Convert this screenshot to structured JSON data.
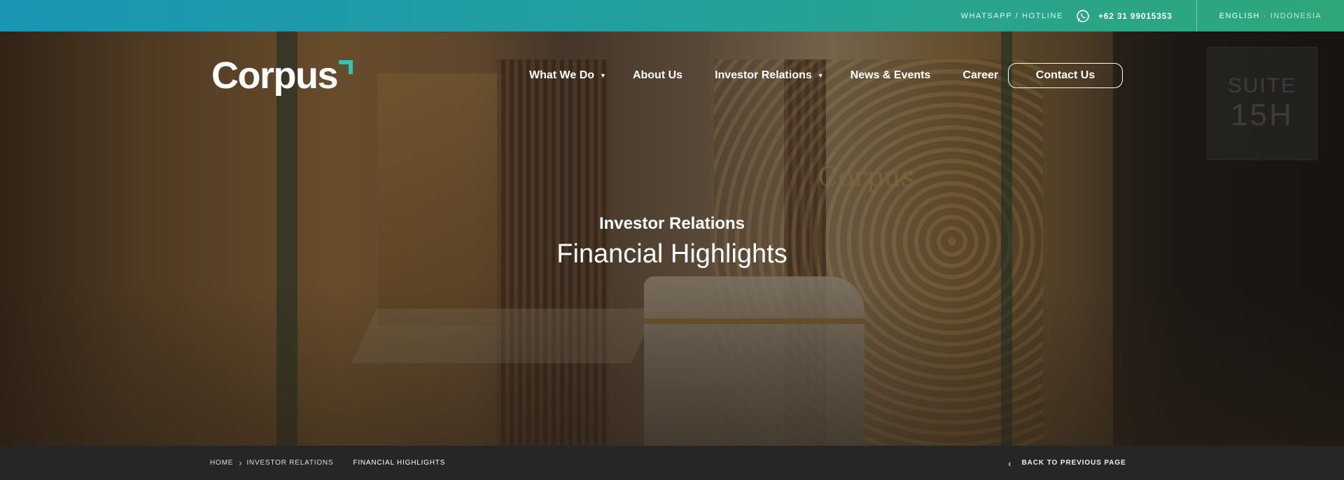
{
  "topbar": {
    "hotline_label": "WHATSAPP / HOTLINE",
    "hotline_icon": "whatsapp-icon",
    "hotline_number": "+62 31 99015353",
    "lang_current": "ENGLISH",
    "lang_separator": "·",
    "lang_other": "INDONESIA"
  },
  "header": {
    "logo": "Corpus",
    "nav": [
      {
        "label": "What We Do",
        "dropdown": true
      },
      {
        "label": "About Us",
        "dropdown": false
      },
      {
        "label": "Investor Relations",
        "dropdown": true
      },
      {
        "label": "News & Events",
        "dropdown": false
      },
      {
        "label": "Career",
        "dropdown": false
      }
    ],
    "contact_label": "Contact Us",
    "caret": "▼"
  },
  "hero": {
    "subtitle": "Investor Relations",
    "title": "Financial Highlights",
    "background_text": {
      "suite_line1": "SUITE",
      "suite_line2": "15H",
      "wall_logo": "Corpus"
    }
  },
  "breadcrumb": {
    "items": [
      "HOME",
      "INVESTOR RELATIONS",
      "FINANCIAL HIGHLIGHTS"
    ],
    "separator": "›",
    "back_label": "BACK TO PREVIOUS PAGE",
    "back_icon": "‹"
  },
  "colors": {
    "topbar_start": "#1a95b4",
    "topbar_end": "#2ea77a",
    "logo_accent": "#2ec4b6",
    "crumbbar_bg": "#262626"
  }
}
